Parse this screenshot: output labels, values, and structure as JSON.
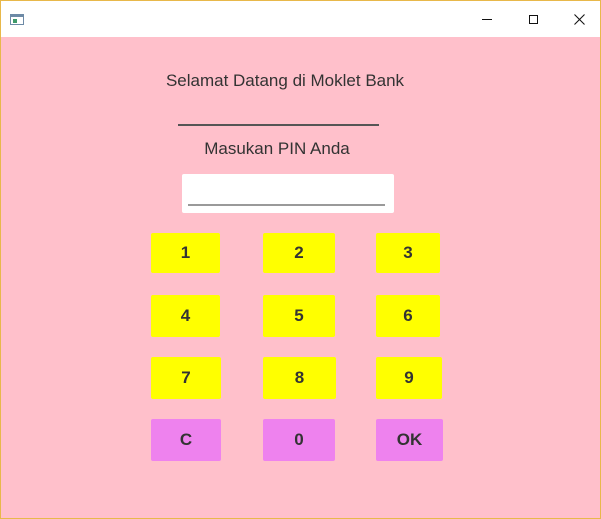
{
  "window": {
    "title": "",
    "controls": {
      "minimize_icon": "minimize-icon",
      "maximize_icon": "maximize-icon",
      "close_glyph": "✕"
    }
  },
  "main": {
    "welcome_text": "Selamat Datang di Moklet Bank",
    "pin_prompt": "Masukan PIN Anda",
    "pin_value": "",
    "pin_placeholder": ""
  },
  "keypad": {
    "keys": [
      "1",
      "2",
      "3",
      "4",
      "5",
      "6",
      "7",
      "8",
      "9",
      "C",
      "0",
      "OK"
    ]
  },
  "colors": {
    "background": "#ffc0cb",
    "digit_key": "#ffff00",
    "action_key": "#ee82ee",
    "text": "#333333"
  }
}
